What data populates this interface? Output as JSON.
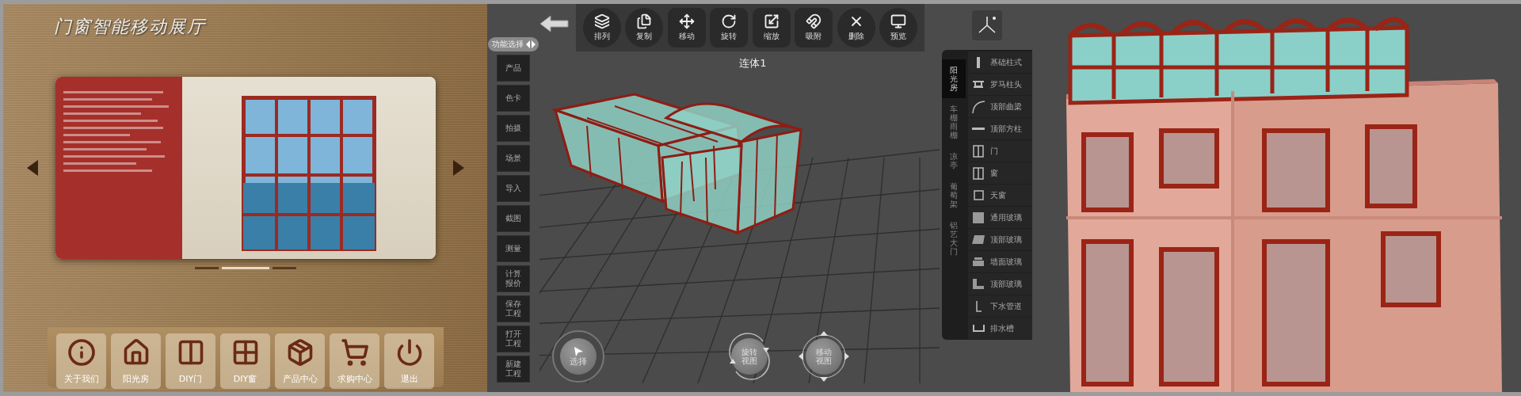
{
  "showroom": {
    "title": "门窗智能移动展厅",
    "pages": [
      {
        "selected": false
      },
      {
        "selected": true
      },
      {
        "selected": false
      }
    ],
    "menu": [
      {
        "label": "关于我们"
      },
      {
        "label": "阳光房"
      },
      {
        "label": "DIY门"
      },
      {
        "label": "DIY窗"
      },
      {
        "label": "产品中心"
      },
      {
        "label": "求购中心"
      },
      {
        "label": "退出"
      }
    ]
  },
  "function_select": {
    "label": "功能选择"
  },
  "side_menu": [
    {
      "label": "产品"
    },
    {
      "label": "色卡"
    },
    {
      "label": "拍摄"
    },
    {
      "label": "场景"
    },
    {
      "label": "导入"
    },
    {
      "label": "截图"
    },
    {
      "label": "测量"
    },
    {
      "label": "计算报价"
    },
    {
      "label": "保存工程"
    },
    {
      "label": "打开工程"
    },
    {
      "label": "新建工程"
    }
  ],
  "toolbar": [
    {
      "label": "排列",
      "kind": "round"
    },
    {
      "label": "复制",
      "kind": "round"
    },
    {
      "label": "移动",
      "kind": "square"
    },
    {
      "label": "旋转",
      "kind": "square"
    },
    {
      "label": "缩放",
      "kind": "square"
    },
    {
      "label": "吸附",
      "kind": "square"
    },
    {
      "label": "删除",
      "kind": "round"
    },
    {
      "label": "预览",
      "kind": "round"
    }
  ],
  "model_name": "连体1",
  "view_controls": [
    {
      "label": "选择",
      "kind": "select"
    },
    {
      "label": "旋转视图",
      "kind": "rotate"
    },
    {
      "label": "移动视图",
      "kind": "pan"
    }
  ],
  "component_library": {
    "categories": [
      {
        "label": "阳光房",
        "selected": true
      },
      {
        "label": "车棚雨棚",
        "selected": false
      },
      {
        "label": "凉亭",
        "selected": false
      },
      {
        "label": "葡萄架",
        "selected": false
      },
      {
        "label": "铝艺大门",
        "selected": false
      }
    ],
    "items": [
      {
        "label": "基础柱式"
      },
      {
        "label": "罗马柱头"
      },
      {
        "label": "顶部曲梁"
      },
      {
        "label": "顶部方柱"
      },
      {
        "label": "门"
      },
      {
        "label": "窗"
      },
      {
        "label": "天窗"
      },
      {
        "label": "通用玻璃"
      },
      {
        "label": "顶部玻璃"
      },
      {
        "label": "墙面玻璃"
      },
      {
        "label": "顶部玻璃"
      },
      {
        "label": "下水管道"
      },
      {
        "label": "排水槽"
      }
    ]
  }
}
